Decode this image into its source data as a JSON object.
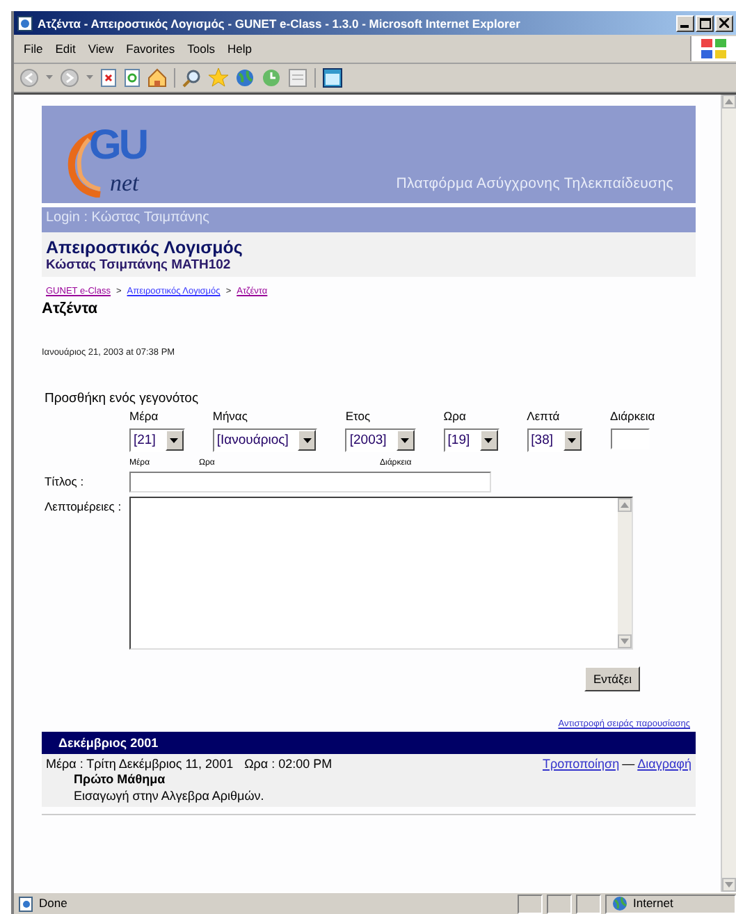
{
  "window": {
    "title": "Ατζέντα - Απειροστικός Λογισμός - GUNET e-Class - 1.3.0 - Microsoft Internet Explorer"
  },
  "menu": [
    "File",
    "Edit",
    "View",
    "Favorites",
    "Tools",
    "Help"
  ],
  "banner": {
    "logo_top": "GU",
    "logo_bottom": "net",
    "tagline": "Πλατφόρμα Ασύγχρονης Τηλεκπαίδευσης"
  },
  "login": "Login : Κώστας Τσιμπάνης",
  "course": {
    "title": "Απειροστικός Λογισμός",
    "subtitle": "Κώστας Τσιμπάνης MATH102"
  },
  "breadcrumb": [
    {
      "label": "GUNET e-Class",
      "visited": true
    },
    {
      "label": "Απειροστικός Λογισμός",
      "visited": false
    },
    {
      "label": "Ατζέντα",
      "visited": true
    }
  ],
  "breadcrumb_separator": ">",
  "heading": "Ατζέντα",
  "datetime": "Ιανουάριος 21, 2003 at 07:38 PM",
  "form": {
    "heading": "Προσθήκη ενός γεγονότος",
    "fields": [
      {
        "label": "Μέρα",
        "kind": "select",
        "value": "[21]"
      },
      {
        "label": "Μήνας",
        "kind": "select",
        "value": "[Ιανουάριος]"
      },
      {
        "label": "Ετος",
        "kind": "select",
        "value": "[2003]"
      },
      {
        "label": "Ωρα",
        "kind": "select",
        "value": "[19]"
      },
      {
        "label": "Λεπτά",
        "kind": "select",
        "value": "[38]"
      },
      {
        "label": "Διάρκεια",
        "kind": "input"
      }
    ],
    "hints": [
      "Μέρα",
      "Ωρα",
      "Διάρκεια"
    ],
    "title_label": "Τίτλος :",
    "details_label": "Λεπτομέρειες :",
    "submit": "Εντάξει"
  },
  "agenda": {
    "reverse_link": "Αντιστροφή σειράς παρουσίασης",
    "month": "Δεκέμβριος 2001",
    "events": [
      {
        "date": "Μέρα : Τρίτη Δεκέμβριος 11, 2001",
        "time": "Ωρα : 02:00 PM",
        "title": "Πρώτο Μάθημα",
        "description": "Εισαγωγή στην Αλγεβρα Αριθμών.",
        "actions": [
          "Τροποποίηση",
          "Διαγραφή"
        ],
        "separator": "—"
      }
    ]
  },
  "status_bar": {
    "text": "Done",
    "zone": "Internet"
  }
}
